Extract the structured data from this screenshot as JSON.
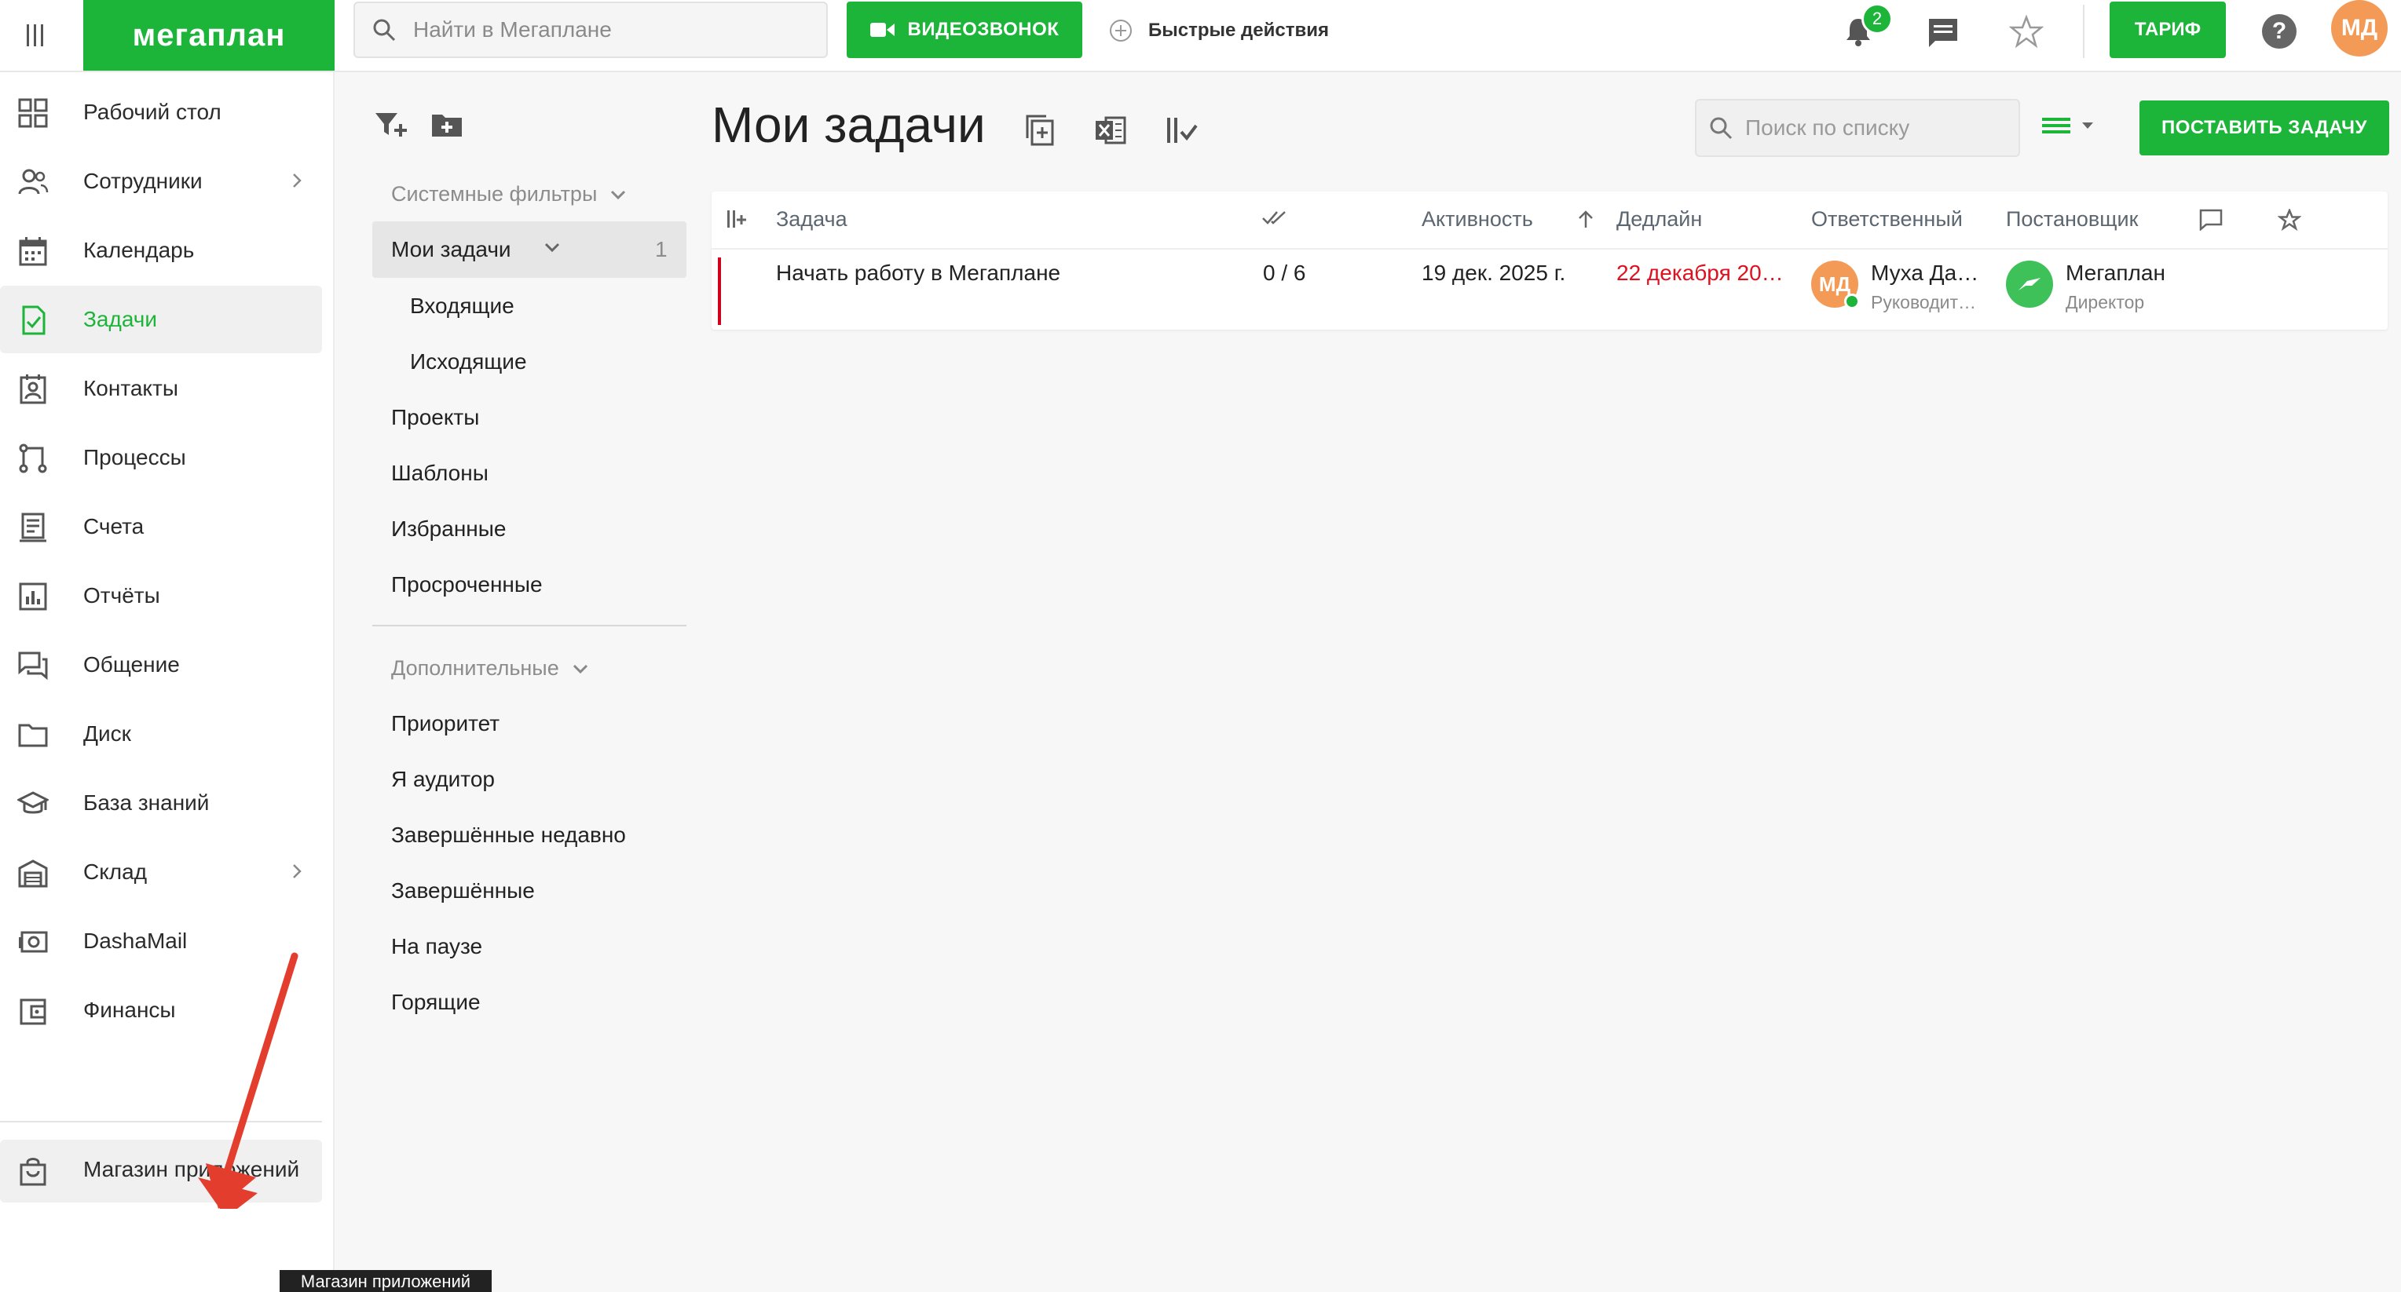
{
  "app": {
    "logo": "мегаплан"
  },
  "topbar": {
    "search_placeholder": "Найти в Мегаплане",
    "video_call": "ВИДЕОЗВОНОК",
    "quick_actions": "Быстрые действия",
    "notifications_count": "2",
    "tariff": "ТАРИФ",
    "help": "?",
    "user_initials": "МД"
  },
  "sidebar": {
    "items": [
      {
        "label": "Рабочий стол",
        "icon": "dashboard-icon"
      },
      {
        "label": "Сотрудники",
        "icon": "users-icon",
        "has_submenu": true
      },
      {
        "label": "Календарь",
        "icon": "calendar-icon"
      },
      {
        "label": "Задачи",
        "icon": "tasks-icon",
        "active": true
      },
      {
        "label": "Контакты",
        "icon": "contacts-icon"
      },
      {
        "label": "Процессы",
        "icon": "processes-icon"
      },
      {
        "label": "Счета",
        "icon": "invoice-icon"
      },
      {
        "label": "Отчёты",
        "icon": "reports-icon"
      },
      {
        "label": "Общение",
        "icon": "chat-icon"
      },
      {
        "label": "Диск",
        "icon": "folder-icon"
      },
      {
        "label": "База знаний",
        "icon": "graduation-cap-icon"
      },
      {
        "label": "Склад",
        "icon": "warehouse-icon",
        "has_submenu": true
      },
      {
        "label": "DashaMail",
        "icon": "mail-icon"
      },
      {
        "label": "Финансы",
        "icon": "wallet-icon"
      }
    ],
    "app_store": "Магазин приложений",
    "tooltip": "Магазин приложений"
  },
  "filters": {
    "system_header": "Системные фильтры",
    "active": {
      "label": "Мои задачи",
      "count": "1"
    },
    "sub_items": [
      "Входящие",
      "Исходящие"
    ],
    "system_items": [
      "Проекты",
      "Шаблоны",
      "Избранные",
      "Просроченные"
    ],
    "extra_header": "Дополнительные",
    "extra_items": [
      "Приоритет",
      "Я аудитор",
      "Завершённые недавно",
      "Завершённые",
      "На паузе",
      "Горящие"
    ]
  },
  "main": {
    "title": "Мои задачи",
    "list_search_placeholder": "Поиск по списку",
    "add_task": "ПОСТАВИТЬ ЗАДАЧУ",
    "columns": {
      "task": "Задача",
      "activity": "Активность",
      "deadline": "Дедлайн",
      "responsible": "Ответственный",
      "author": "Постановщик"
    },
    "rows": [
      {
        "task": "Начать работу в Мегаплане",
        "progress": "0 / 6",
        "activity": "19 дек. 2025 г.",
        "deadline": "22 декабря 20…",
        "responsible": {
          "initials": "МД",
          "name": "Муха Да…",
          "role": "Руководит…"
        },
        "author": {
          "name": "Мегаплан",
          "role": "Директор"
        },
        "priority_color": "#d0021b"
      }
    ]
  },
  "colors": {
    "accent": "#1db43a",
    "overdue": "#e0101e",
    "avatar": "#f39a57"
  }
}
